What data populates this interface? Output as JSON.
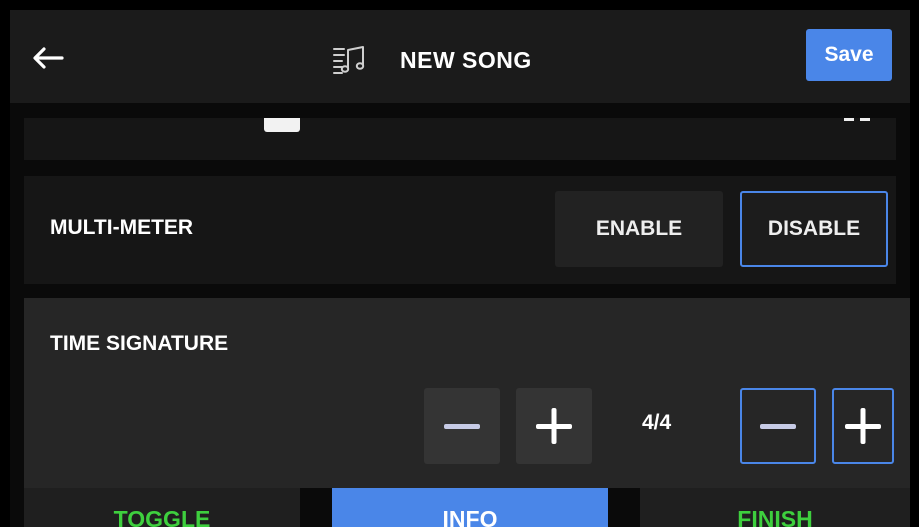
{
  "header": {
    "title": "NEW SONG",
    "save_label": "Save",
    "back_icon": "arrow-left-icon",
    "title_icon": "music-list-icon"
  },
  "multi_meter": {
    "label": "MULTI-METER",
    "options": [
      "ENABLE",
      "DISABLE"
    ],
    "selected": "DISABLE"
  },
  "time_signature": {
    "label": "TIME SIGNATURE",
    "value": "4/4"
  },
  "tabs": [
    {
      "label": "TOGGLE"
    },
    {
      "label": "INFO"
    },
    {
      "label": "FINISH"
    }
  ],
  "colors": {
    "accent": "#4a86e8",
    "tab_green": "#3ecf3e",
    "header_bg": "#1b1b1b",
    "panel_bg": "#262626"
  }
}
